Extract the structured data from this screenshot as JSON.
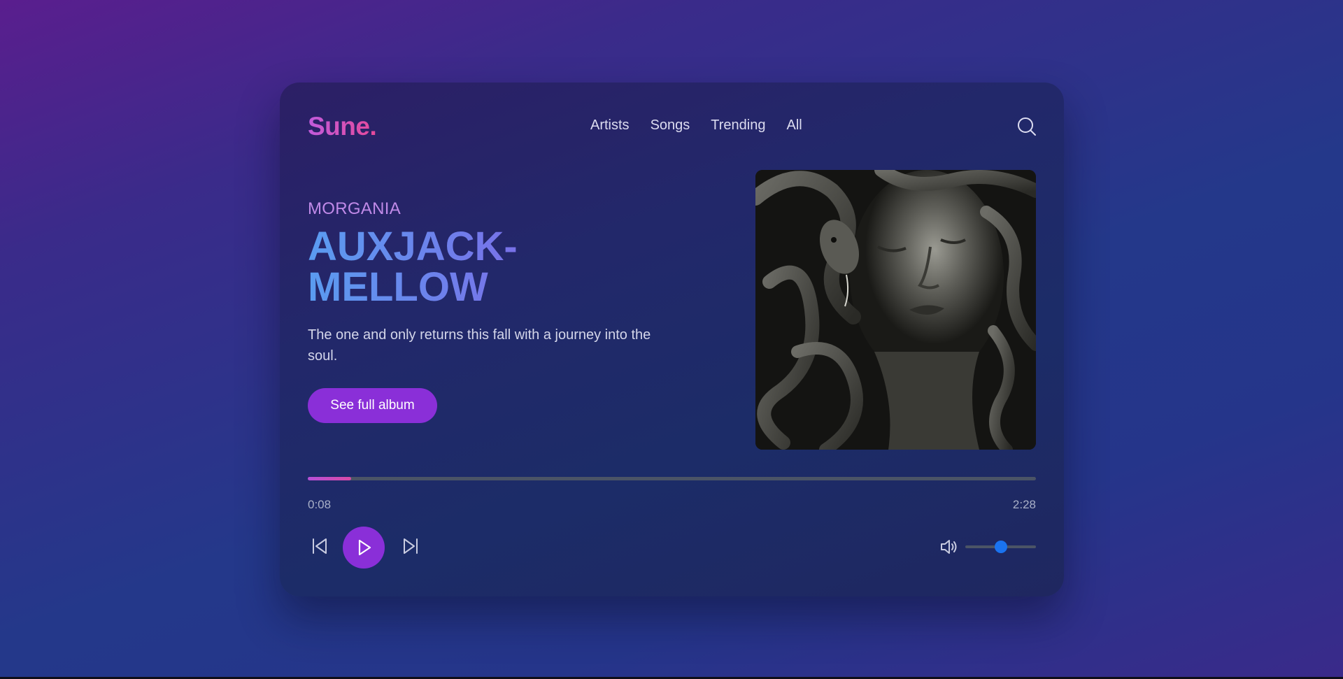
{
  "brand": {
    "logo": "Sune.",
    "gradient": [
      "#c15bdc",
      "#e64a9a"
    ]
  },
  "nav": {
    "items": [
      "Artists",
      "Songs",
      "Trending",
      "All"
    ]
  },
  "search": {
    "icon": "search-icon"
  },
  "hero": {
    "artist": "MORGANIA",
    "title_line1": "AUXJACK-",
    "title_line2": "MELLOW",
    "description": "The one and only returns this fall with a journey into the soul.",
    "cta_label": "See full album",
    "cover_alt": "Album cover: face of a stone statue surrounded by snakes"
  },
  "player": {
    "current_time": "0:08",
    "total_time": "2:28",
    "progress_fraction": 0.06,
    "volume_fraction": 0.5,
    "controls": {
      "prev_icon": "skip-back-icon",
      "play_icon": "play-icon",
      "next_icon": "skip-forward-icon",
      "volume_icon": "volume-icon"
    }
  },
  "colors": {
    "accent": "#8a2fd8",
    "progress": "#c04ccc",
    "volume_thumb": "#1a73f0"
  }
}
